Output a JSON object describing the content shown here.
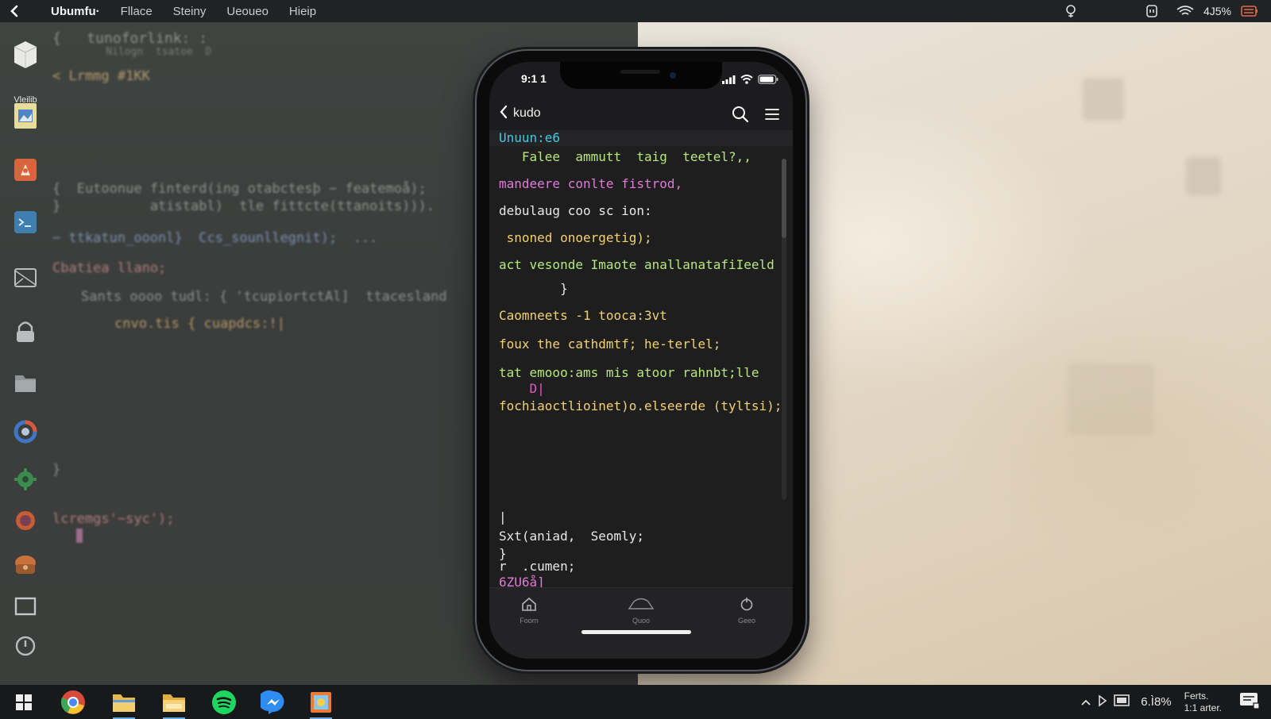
{
  "menubar": {
    "app": "Ubumfu·",
    "items": [
      "Fllace",
      "Steiny",
      "Ueoueo",
      "Hieip"
    ],
    "battery": "4J5%"
  },
  "dock": {
    "first_label": "Vleilib"
  },
  "background_code": [
    "{   tunoforlink: :",
    "    Nilogn  tsatoe  D",
    "< Lrmmg #1KK",
    "{  Eutoonue finterd(ing otabctesþ − featemoå);",
    "}           atistabl)  tle fittcte(ttanoits))).",
    "− ttkatun_ooonl}  Ccs_sounllegnit);  ...",
    "Cbatiea llano;",
    "Sants oooo tudl: { 'tcupiortctAl]  ttacesland",
    "cnvo.tis { cuapdcs:!|",
    "}",
    "lcremgs'−syc');"
  ],
  "phone": {
    "time": "9:1 1",
    "nav_title": "kudo",
    "code_lines": [
      {
        "text": "Unuun:e6",
        "cls": "c-cyan"
      },
      {
        "text": "   Falee  ammutt  taig  teetel?,,",
        "cls": "c-green"
      },
      {
        "text": "mandeere conlte fistrod,",
        "cls": "c-pink"
      },
      {
        "text": "debulaug coo sc ion:",
        "cls": "c-white"
      },
      {
        "text": " snoned onoergetig);",
        "cls": "c-yellow"
      },
      {
        "text": "act vesonde Imaote anallanatafiIeeld",
        "cls": "c-green"
      },
      {
        "text": "        }",
        "cls": "c-white"
      },
      {
        "text": "Caomneets -1 tooca:3vt",
        "cls": "c-yellow"
      },
      {
        "text": "foux the cathdmtf; he-terlel;",
        "cls": "c-yellow"
      },
      {
        "text": "tat emooo:ams mis atoor rahnbt;lle",
        "cls": "c-green"
      },
      {
        "text": "    D|",
        "cls": "c-magenta"
      },
      {
        "text": "fochiaoctlioinet)o.elseerde (tyltsi);",
        "cls": "c-yellow"
      },
      {
        "text": "|",
        "cls": "c-white"
      },
      {
        "text": "Sxt(aniad,  Seomly;",
        "cls": "c-white"
      },
      {
        "text": "}",
        "cls": "c-white"
      },
      {
        "text": "r  .cumen;",
        "cls": "c-white"
      },
      {
        "text": "6ZU6å]",
        "cls": "c-pink"
      }
    ],
    "tabs": [
      {
        "label": "Foorn",
        "icon": "home-icon"
      },
      {
        "label": "Quoo",
        "icon": "cloud-icon"
      },
      {
        "label": "Geeo",
        "icon": "power-icon"
      }
    ]
  },
  "taskbar": {
    "tray_percent": "6.Ì8%",
    "clock_line1": "Ferts.",
    "clock_line2": "1:1 arter."
  },
  "colors": {
    "accent_blue": "#43c9e0",
    "menubar_bg": "#202326",
    "taskbar_bg": "#17191b"
  }
}
